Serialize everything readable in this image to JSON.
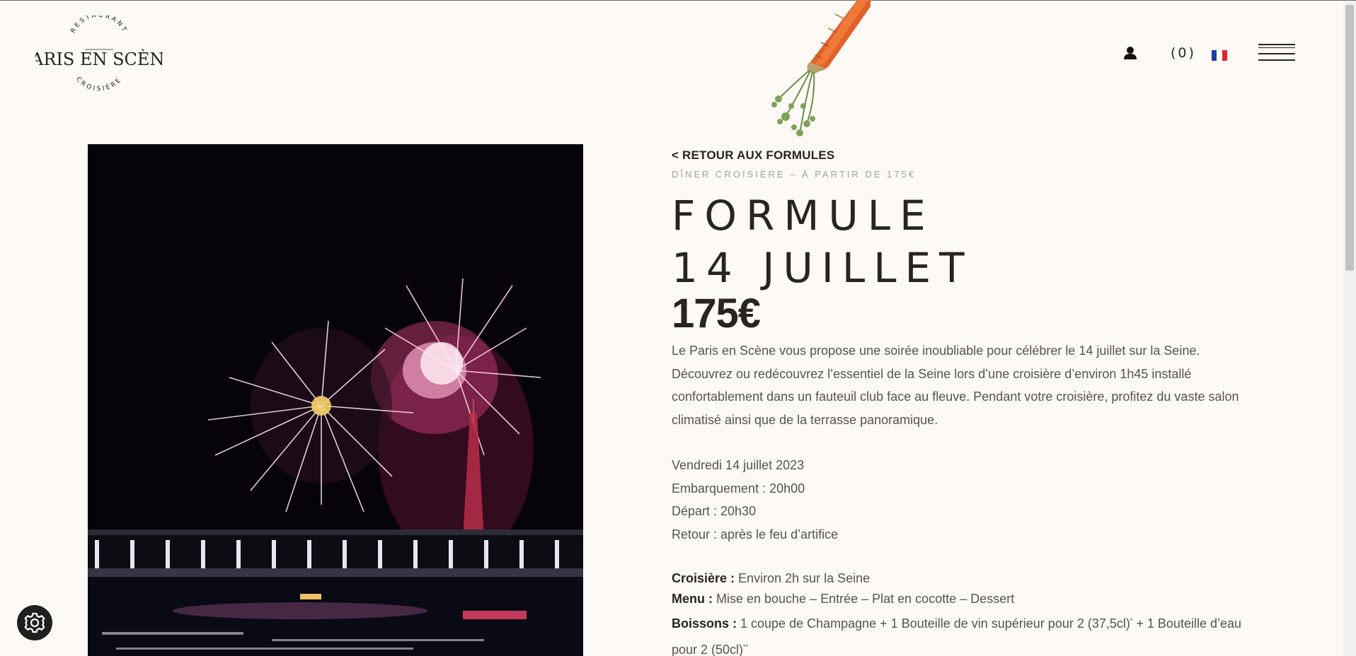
{
  "header": {
    "logo": {
      "top_arc": "RESTAURANT",
      "name": "PARIS EN SCÈNE",
      "bottom_arc": "CROISIÈRE"
    },
    "cart_count": "(0)",
    "language_flag": "fr-flag-icon",
    "menu_icon": "hamburger-menu-icon",
    "user_icon": "user-icon"
  },
  "content": {
    "back_link": "< RETOUR AUX FORMULES",
    "subtitle": "DÎNER CROISIÈRE – À PARTIR DE 175€",
    "title_line1": "FORMULE",
    "title_line2": "14 JUILLET",
    "price": "175€",
    "description": "Le Paris en Scène vous propose une soirée inoubliable pour célébrer le 14 juillet sur la Seine. Découvrez ou redécouvrez l’essentiel de la Seine lors d’une croisière d’environ 1h45 installé confortablement dans un fauteuil club face au fleuve. Pendant votre croisière, profitez du vaste salon climatisé ainsi que de la terrasse panoramique.",
    "schedule": [
      "Vendredi 14 juillet 2023",
      "Embarquement : 20h00",
      "Départ : 20h30",
      "Retour : après le feu d’artifice"
    ],
    "details": {
      "cruise_label": "Croisière :",
      "cruise_value": " Environ 2h sur la Seine",
      "menu_label": "Menu :",
      "menu_value": " Mise en bouche – Entrée – Plat en cocotte – Dessert",
      "drinks_label": "Boissons :",
      "drinks_value_1": "  1 coupe de Champagne + 1 Bouteille  de vin supérieur pour 2 (37,5cl)",
      "drinks_mark_1": "*",
      "drinks_value_2": " + 1 Bouteille d’eau pour 2 (50cl)",
      "drinks_mark_2": "**"
    }
  },
  "widgets": {
    "settings_icon": "gear-icon"
  },
  "colors": {
    "background": "#fdf9f5",
    "text_dark": "#2b231f",
    "text_body": "#5b524c",
    "text_muted": "#a79f98"
  }
}
